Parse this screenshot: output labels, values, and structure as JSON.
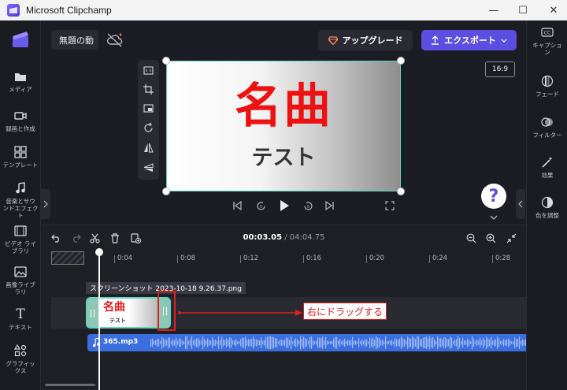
{
  "window": {
    "title": "Microsoft Clipchamp",
    "minimize": "—",
    "maximize": "☐",
    "close": "✕"
  },
  "left_nav": [
    {
      "label": "メディア",
      "icon": "folder-icon"
    },
    {
      "label": "録画と作成",
      "icon": "camera-icon"
    },
    {
      "label": "テンプレート",
      "icon": "templates-icon"
    },
    {
      "label": "音楽とサウ\nンドエフェクト",
      "icon": "music-icon"
    },
    {
      "label": "ビデオ ライ\nブラリ",
      "icon": "film-icon"
    },
    {
      "label": "画像ライブ\nラリ",
      "icon": "image-icon"
    },
    {
      "label": "テキスト",
      "icon": "text-icon"
    },
    {
      "label": "グラフィッ\nクス",
      "icon": "shapes-icon"
    }
  ],
  "right_nav": [
    {
      "label": "キャプショ\nン",
      "icon": "cc-icon"
    },
    {
      "label": "フェード",
      "icon": "fade-icon"
    },
    {
      "label": "フィルター",
      "icon": "filter-icon"
    },
    {
      "label": "効果",
      "icon": "magic-wand-icon"
    },
    {
      "label": "色を調整",
      "icon": "color-adjust-icon"
    }
  ],
  "header": {
    "project_name": "無題の動",
    "upgrade_label": "アップグレード",
    "export_label": "エクスポート",
    "colors": {
      "accent": "#5b4ee0",
      "selection": "#5fd6c0",
      "upgrade_gem": "#ff8a5c"
    }
  },
  "preview": {
    "title_text": "名曲",
    "subtitle_text": "テスト",
    "aspect_ratio": "16:9",
    "help_label": "?",
    "title_color": "#ee1111"
  },
  "timeline": {
    "current_time": "00:03.05",
    "separator": " / ",
    "total_time": "04:04.75",
    "ticks": [
      "0:04",
      "0:08",
      "0:12",
      "0:16",
      "0:20",
      "0:24",
      "0:28"
    ],
    "image_clip_name": "スクリーンショット 2023-10-18 9.26.37.png",
    "clip_title": "名曲",
    "clip_subtitle": "テスト",
    "audio_clip_name": "365.mp3",
    "annotation_text": "右にドラッグする",
    "colors": {
      "audio": "#3b6fe0",
      "annotation": "#e02020"
    }
  }
}
